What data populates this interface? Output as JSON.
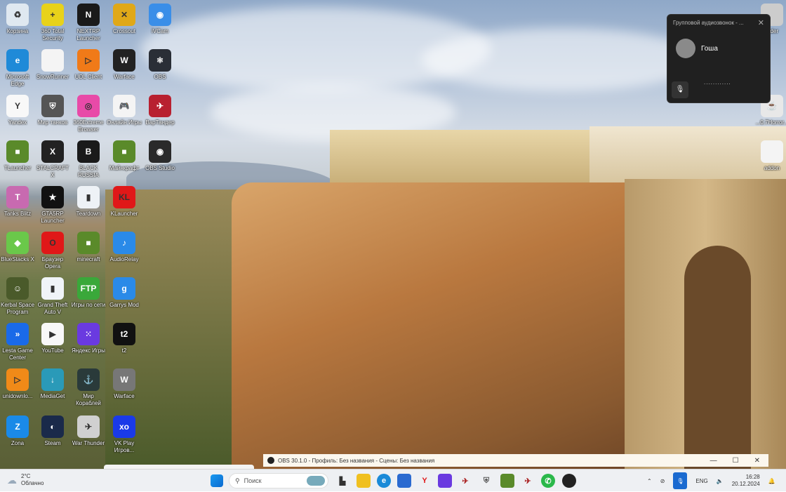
{
  "desktop": {
    "icons": [
      {
        "label": "Корзина",
        "color": "#dfe8f0",
        "glyph": "♻"
      },
      {
        "label": "360 Total Security",
        "color": "#e8d21a",
        "glyph": "+"
      },
      {
        "label": "NEXTRP Launcher",
        "color": "#1a1a1a",
        "glyph": "N"
      },
      {
        "label": "Crossout",
        "color": "#e0a818",
        "glyph": "✕"
      },
      {
        "label": "iVCam",
        "color": "#3a8ee8",
        "glyph": "◉"
      },
      {
        "label": "Microsoft Edge",
        "color": "#1f8ad8",
        "glyph": "e"
      },
      {
        "label": "SnowRunner",
        "color": "#f4f4f4",
        "glyph": ""
      },
      {
        "label": "UDL Client",
        "color": "#f07a18",
        "glyph": "▷"
      },
      {
        "label": "Warface",
        "color": "#222",
        "glyph": "W"
      },
      {
        "label": "OBS",
        "color": "#2a2e36",
        "glyph": "⚛"
      },
      {
        "label": "Yandex",
        "color": "#f8f8f8",
        "glyph": "Y"
      },
      {
        "label": "Мир танков",
        "color": "#555",
        "glyph": "⛨"
      },
      {
        "label": "360Extreme Browser",
        "color": "#e84aa8",
        "glyph": "◎"
      },
      {
        "label": "Онлайн Игры",
        "color": "#f4f4f4",
        "glyph": "🎮"
      },
      {
        "label": "ВарТандер",
        "color": "#b82030",
        "glyph": "✈"
      },
      {
        "label": "TLauncher",
        "color": "#5a8a2a",
        "glyph": "■"
      },
      {
        "label": "STALCRAFT X",
        "color": "#222",
        "glyph": "X"
      },
      {
        "label": "BLACK RUSSIA",
        "color": "#1a1a1a",
        "glyph": "B"
      },
      {
        "label": "Майнкрафт",
        "color": "#5a8a2a",
        "glyph": "■"
      },
      {
        "label": "OBS Studio",
        "color": "#2a2a2a",
        "glyph": "◉"
      },
      {
        "label": "Tanks Blitz",
        "color": "#c86ab0",
        "glyph": "T"
      },
      {
        "label": "GTA5RP Launcher",
        "color": "#111",
        "glyph": "★"
      },
      {
        "label": "Teardown",
        "color": "#eef2f6",
        "glyph": "▮"
      },
      {
        "label": "KLauncher",
        "color": "#e01818",
        "glyph": "KL"
      },
      {
        "label": "",
        "color": "",
        "glyph": ""
      },
      {
        "label": "BlueStacks X",
        "color": "#6ac84a",
        "glyph": "◆"
      },
      {
        "label": "Браузер Opera",
        "color": "#e01818",
        "glyph": "O"
      },
      {
        "label": "minecraft",
        "color": "#5a8a2a",
        "glyph": "■"
      },
      {
        "label": "AudioRelay",
        "color": "#2a8ae8",
        "glyph": "♪"
      },
      {
        "label": "",
        "color": "",
        "glyph": ""
      },
      {
        "label": "Kerbal Space Program",
        "color": "#4a5a2a",
        "glyph": "☺"
      },
      {
        "label": "Grand Theft Auto V",
        "color": "#f0f4f8",
        "glyph": "▮"
      },
      {
        "label": "Игры по сети",
        "color": "#3aa83a",
        "glyph": "FTP"
      },
      {
        "label": "Garrys Mod",
        "color": "#2a8ae8",
        "glyph": "g"
      },
      {
        "label": "",
        "color": "",
        "glyph": ""
      },
      {
        "label": "Lesta Game Center",
        "color": "#1a6ae8",
        "glyph": "»"
      },
      {
        "label": "YouTube",
        "color": "#f8f8f8",
        "glyph": "▶"
      },
      {
        "label": "Яндекс Игры",
        "color": "#6a3ae0",
        "glyph": "⁙"
      },
      {
        "label": "t2",
        "color": "#111",
        "glyph": "t2"
      },
      {
        "label": "",
        "color": "",
        "glyph": ""
      },
      {
        "label": "unidownlo...",
        "color": "#f08a18",
        "glyph": "▷"
      },
      {
        "label": "MediaGet",
        "color": "#2a9ab8",
        "glyph": "↓"
      },
      {
        "label": "Мир Кораблей",
        "color": "#2a3a3a",
        "glyph": "⚓"
      },
      {
        "label": "Warface",
        "color": "#777",
        "glyph": "W"
      },
      {
        "label": "",
        "color": "",
        "glyph": ""
      },
      {
        "label": "Zona",
        "color": "#1a8ae8",
        "glyph": "Z"
      },
      {
        "label": "Steam",
        "color": "#1a2a4a",
        "glyph": "◐"
      },
      {
        "label": "War Thunder",
        "color": "#d0d0d0",
        "glyph": "✈"
      },
      {
        "label": "VK Play Игров...",
        "color": "#1a3ae8",
        "glyph": "xo"
      },
      {
        "label": "",
        "color": "",
        "glyph": ""
      }
    ],
    "right_icons": [
      {
        "label": "...der",
        "color": "#ccc",
        "glyph": ""
      },
      {
        "label": "...0.7Horror...",
        "color": "#e8e8e8",
        "glyph": "☕"
      },
      {
        "label": "addon",
        "color": "#f4f4f4",
        "glyph": ""
      }
    ]
  },
  "call_popup": {
    "title": "Групповой аудиозвонок - ...",
    "participant": "Гоша",
    "status": "............"
  },
  "obs_window": {
    "title": "OBS 30.1.0 - Профиль: Без названия - Сцены: Без названия",
    "minimize": "—",
    "maximize": "☐",
    "close": "✕"
  },
  "taskbar": {
    "weather_temp": "2°C",
    "weather_desc": "Облачно",
    "search_placeholder": "Поиск",
    "language": "ENG",
    "time": "16:28",
    "date": "20.12.2024"
  }
}
